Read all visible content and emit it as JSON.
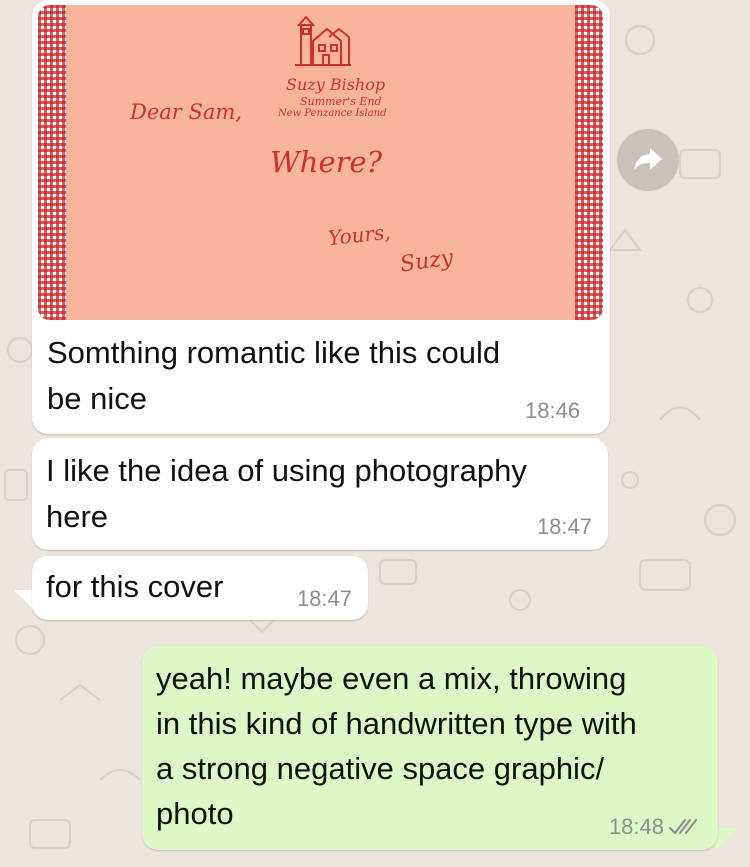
{
  "colors": {
    "wallpaper": "#ece5dd",
    "incoming_bubble": "#ffffff",
    "outgoing_bubble": "#dcf8c6",
    "timestamp": "#8f8f8f",
    "image_background": "#f8b59b",
    "image_ink": "#d02f2f"
  },
  "image_message": {
    "image": {
      "sender_name": "Suzy Bishop",
      "sender_line2": "Summer's End",
      "sender_line3": "New Penzance Island",
      "greeting": "Dear Sam,",
      "body": "Where?",
      "closing": "Yours,",
      "signature": "Suzy"
    },
    "caption": "Somthing romantic like this could\nbe nice",
    "time": "18:46",
    "forward_icon": "forward-arrow-icon"
  },
  "messages": [
    {
      "direction": "incoming",
      "text": "I like the idea of using photography\nhere",
      "time": "18:47"
    },
    {
      "direction": "incoming",
      "text": "for this cover",
      "time": "18:47"
    },
    {
      "direction": "outgoing",
      "text": "yeah! maybe even a mix, throwing\nin this kind of handwritten type with\na strong negative space graphic/\nphoto",
      "time": "18:48",
      "status_icon": "double-check-icon"
    }
  ]
}
